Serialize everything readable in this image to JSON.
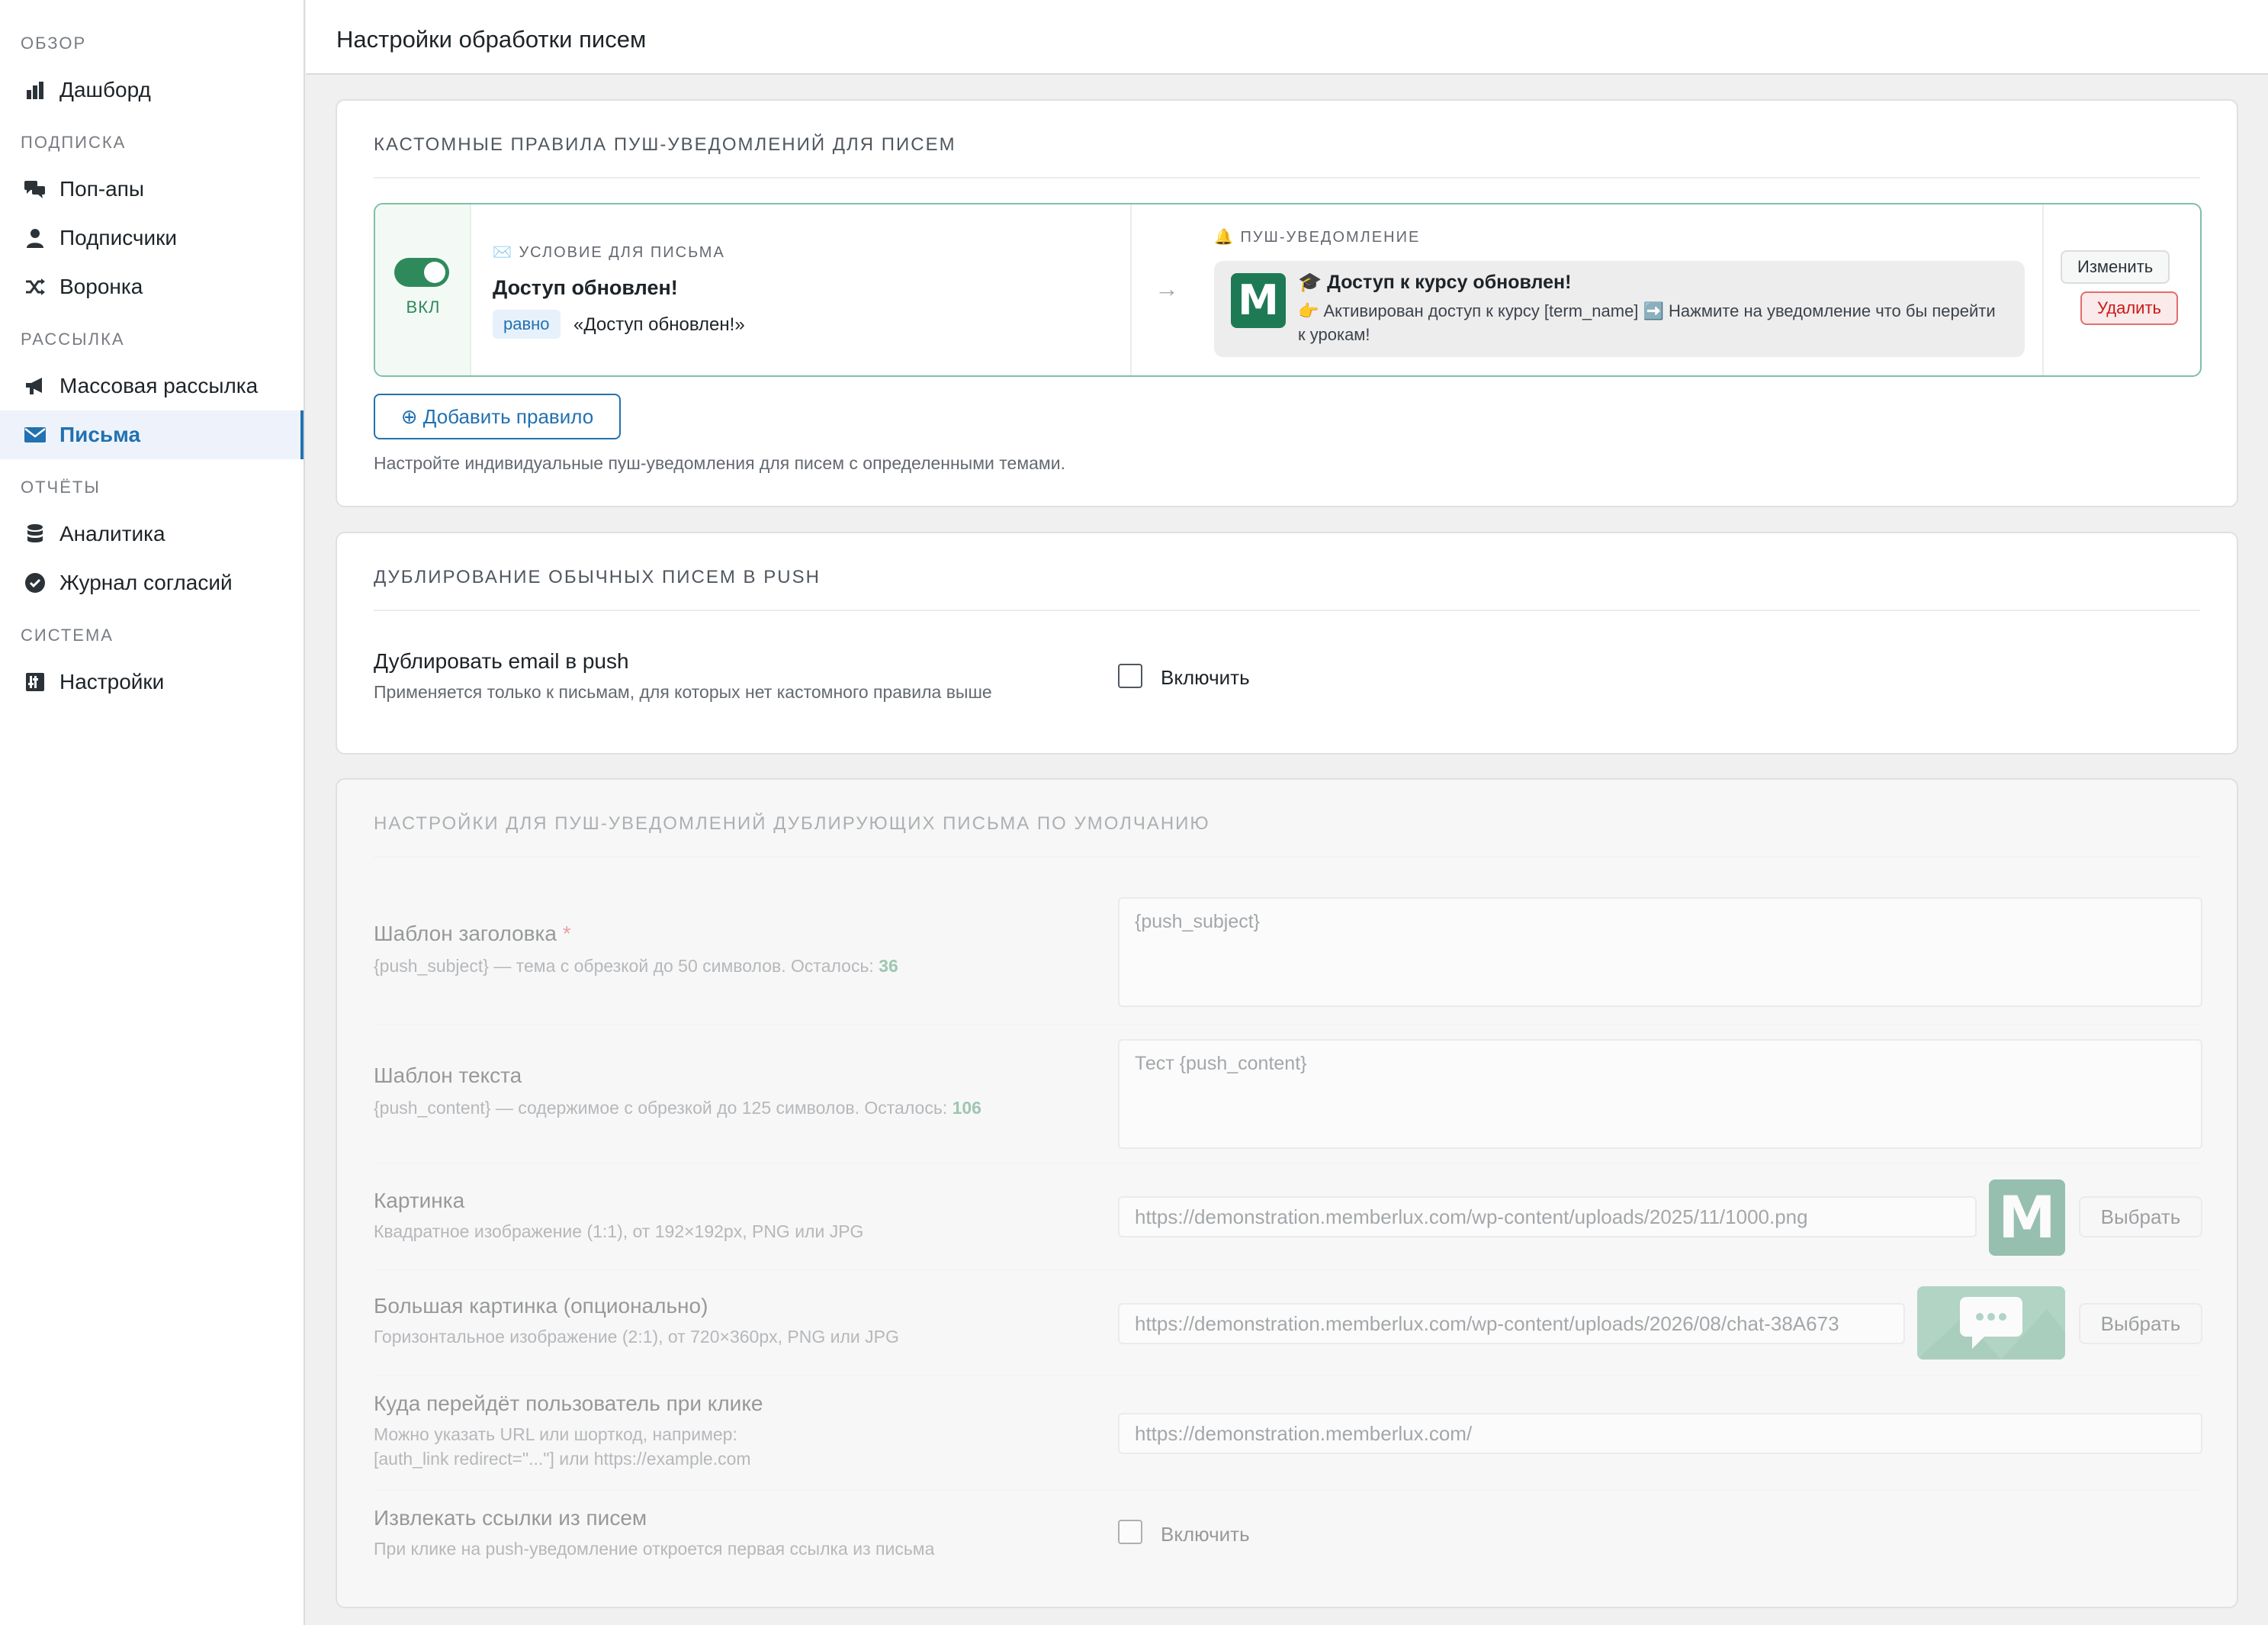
{
  "sidebar": {
    "sections": [
      {
        "title": "ОБЗОР",
        "items": [
          {
            "label": "Дашборд",
            "icon": "bar-chart-icon"
          }
        ]
      },
      {
        "title": "ПОДПИСКА",
        "items": [
          {
            "label": "Поп-апы",
            "icon": "chat-bubbles-icon"
          },
          {
            "label": "Подписчики",
            "icon": "user-icon"
          },
          {
            "label": "Воронка",
            "icon": "shuffle-icon"
          }
        ]
      },
      {
        "title": "РАССЫЛКА",
        "items": [
          {
            "label": "Массовая рассылка",
            "icon": "megaphone-icon"
          },
          {
            "label": "Письма",
            "icon": "envelope-icon",
            "active": true
          }
        ]
      },
      {
        "title": "ОТЧЁТЫ",
        "items": [
          {
            "label": "Аналитика",
            "icon": "database-icon"
          },
          {
            "label": "Журнал согласий",
            "icon": "check-circle-icon"
          }
        ]
      },
      {
        "title": "СИСТЕМА",
        "items": [
          {
            "label": "Настройки",
            "icon": "settings-panel-icon"
          }
        ]
      }
    ]
  },
  "page": {
    "title": "Настройки обработки писем"
  },
  "custom_rules": {
    "title": "КАСТОМНЫЕ ПРАВИЛА ПУШ-УВЕДОМЛЕНИЙ ДЛЯ ПИСЕМ",
    "rule": {
      "toggle_label": "ВКЛ",
      "condition_label": "✉️ УСЛОВИЕ ДЛЯ ПИСЬМА",
      "condition_name": "Доступ обновлен!",
      "operator": "равно",
      "condition_value": "«Доступ обновлен!»",
      "push_label": "🔔 ПУШ-УВЕДОМЛЕНИЕ",
      "push_logo": "M",
      "push_title": "🎓 Доступ к курсу обновлен!",
      "push_body": "👉 Активирован доступ к курсу [term_name] ➡️ Нажмите на уведомление что бы перейти к урокам!",
      "edit_label": "Изменить",
      "delete_label": "Удалить"
    },
    "add_button": "⊕ Добавить правило",
    "help": "Настройте индивидуальные пуш-уведомления для писем с определенными темами."
  },
  "duplicate": {
    "title": "ДУБЛИРОВАНИЕ ОБЫЧНЫХ ПИСЕМ В PUSH",
    "label": "Дублировать email в push",
    "hint": "Применяется только к письмам, для которых нет кастомного правила выше",
    "checkbox_label": "Включить",
    "checked": false
  },
  "defaults": {
    "title": "НАСТРОЙКИ ДЛЯ ПУШ-УВЕДОМЛЕНИЙ ДУБЛИРУЮЩИХ ПИСЬМА ПО УМОЛЧАНИЮ",
    "subject": {
      "label": "Шаблон заголовка",
      "required": "*",
      "hint": "{push_subject} — тема с обрезкой до 50 символов. Осталось:",
      "remaining": "36",
      "value": "{push_subject}"
    },
    "text": {
      "label": "Шаблон текста",
      "hint": "{push_content} — содержимое с обрезкой до 125 символов. Осталось:",
      "remaining": "106",
      "value": "Тест {push_content}"
    },
    "image": {
      "label": "Картинка",
      "hint": "Квадратное изображение (1:1), от 192×192px, PNG или JPG",
      "value": "https://demonstration.memberlux.com/wp-content/uploads/2025/11/1000.png",
      "choose": "Выбрать",
      "thumb_letter": "M"
    },
    "big_image": {
      "label": "Большая картинка (опционально)",
      "hint": "Горизонтальное изображение (2:1), от 720×360px, PNG или JPG",
      "value": "https://demonstration.memberlux.com/wp-content/uploads/2026/08/chat-38A673",
      "choose": "Выбрать"
    },
    "click_url": {
      "label": "Куда перейдёт пользователь при клике",
      "hint1": "Можно указать URL или шорткод, например:",
      "hint2": "[auth_link redirect=\"...\"] или https://example.com",
      "value": "https://demonstration.memberlux.com/"
    },
    "extract_links": {
      "label": "Извлекать ссылки из писем",
      "hint": "При клике на push-уведомление откроется первая ссылка из письма",
      "checkbox_label": "Включить",
      "checked": false
    }
  },
  "colors": {
    "accent": "#2271b1",
    "green": "#2f8a5b",
    "danger": "#cc1818"
  }
}
